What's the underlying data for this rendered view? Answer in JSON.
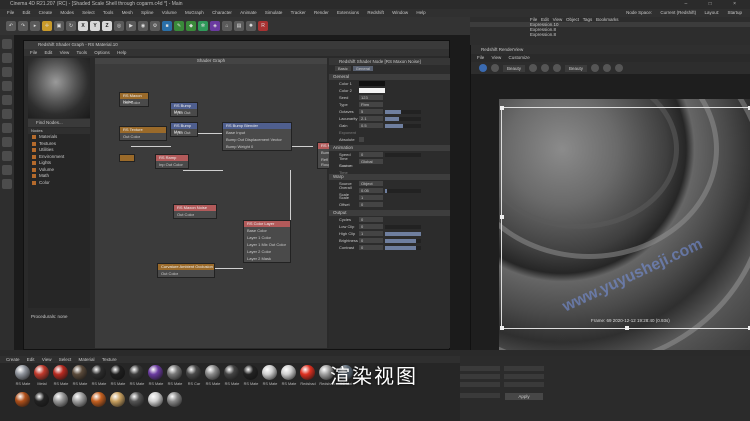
{
  "window": {
    "title": "Cinema 4D R21.207 (RC) - [Shaded Scale Shell through cogarm.c4d *] - Main",
    "controls": [
      "–",
      "□",
      "×"
    ]
  },
  "menubar": {
    "items": [
      "File",
      "Edit",
      "Create",
      "Modes",
      "Select",
      "Tools",
      "Mesh",
      "Spline",
      "Volume",
      "MoGraph",
      "Character",
      "Animate",
      "Simulate",
      "Tracker",
      "Render",
      "Extensions",
      "Redshift",
      "Window",
      "Help"
    ],
    "node_space_label": "Node Space:",
    "node_space_value": "Current (Redshift)",
    "layout_label": "Layout:",
    "layout_value": "Startup"
  },
  "toolbar": {
    "axis_buttons": [
      "X",
      "Y",
      "Z"
    ]
  },
  "object_manager": {
    "menu": [
      "File",
      "Edit",
      "View",
      "Object",
      "Tags",
      "Bookmarks"
    ],
    "rows": [
      "Expression.10",
      "Expression.8",
      "Expression.8"
    ]
  },
  "shader_graph": {
    "title": "Redshift Shader Graph - RS Material.10",
    "menu": [
      "File",
      "Edit",
      "View",
      "Tools",
      "Options",
      "Help"
    ],
    "graph_title": "Shader Graph",
    "find_nodes_placeholder": "Find Nodes...",
    "nodes_header": "Nodes",
    "categories": [
      "Materials",
      "Textures",
      "Utilities",
      "Environment",
      "Lights",
      "Volume",
      "Math",
      "Color"
    ],
    "properties_label": "Procedurals: none",
    "nodes": [
      {
        "name": "RS Maxon Noise",
        "ports": [
          "Out Color"
        ]
      },
      {
        "name": "RS Bump Map",
        "ports": [
          "Input Out"
        ]
      },
      {
        "name": "RS Bump Map",
        "ports": [
          "Input Out"
        ]
      },
      {
        "name": "RS Texture",
        "ports": [
          "Out Color"
        ]
      },
      {
        "name": "RS Bump Blender",
        "ports": [
          "Base Input",
          "Bump Out Displacement Vector",
          "Bump Weight 0"
        ]
      },
      {
        "name": "RS Ramp",
        "ports": [
          "Inp Out Color"
        ]
      },
      {
        "name": "RS Mat",
        "ports": [
          "Bump Input",
          "Refl Roughness"
        ]
      },
      {
        "name": "RS Maxon Noise",
        "ports": [
          "Out Color"
        ]
      },
      {
        "name": "RS Color Layer",
        "ports": [
          "Base Color",
          "Layer 1 Color",
          "Layer 1 Mix Out Color",
          "Layer 2 Color",
          "Layer 2 Mask"
        ]
      },
      {
        "name": "Curvature Ambient Occlusion",
        "ports": [
          "Out Color"
        ]
      }
    ]
  },
  "attributes": {
    "header": "Redshift Shader Node [RS Maxon Noise]",
    "tabs": [
      "Basic",
      "General"
    ],
    "active_tab": "General",
    "sections": {
      "general": "General",
      "animation": "Animation",
      "warp": "Warp",
      "output": "Output"
    },
    "general_props": [
      {
        "label": "Color 1",
        "value": "",
        "fill": 0
      },
      {
        "label": "Color 2",
        "value": "",
        "fill": 0
      },
      {
        "label": "Seed",
        "value": "123",
        "fill": 0
      },
      {
        "label": "Type",
        "value": "Fbm",
        "fill": 0
      },
      {
        "label": "Octaves",
        "value": "5",
        "fill": 0.45
      },
      {
        "label": "Lacunarity",
        "value": "2.1",
        "fill": 0.4
      },
      {
        "label": "Gain",
        "value": "0.5",
        "fill": 0.5
      },
      {
        "label": "Exponent",
        "value": "",
        "fill": 0
      },
      {
        "label": "Absolute",
        "value": "",
        "fill": 0
      }
    ],
    "animation_props": [
      {
        "label": "Speed",
        "value": "0",
        "fill": 0
      },
      {
        "label": "Time Source",
        "value": "Global",
        "fill": 0
      },
      {
        "label": "Custom Time",
        "value": "",
        "fill": 0
      }
    ],
    "warp_props": [
      {
        "label": "Source",
        "value": "Object",
        "fill": 0
      },
      {
        "label": "Overall Scale",
        "value": "0.05",
        "fill": 0.05
      },
      {
        "label": "Scale",
        "value": "1",
        "fill": 0
      },
      {
        "label": "Offset",
        "value": "0",
        "fill": 0
      }
    ],
    "output_props": [
      {
        "label": "Cycles",
        "value": "0",
        "fill": 0
      },
      {
        "label": "Low Clip",
        "value": "0",
        "fill": 0
      },
      {
        "label": "High Clip",
        "value": "1",
        "fill": 1
      },
      {
        "label": "Brightness",
        "value": "0",
        "fill": 0.85
      },
      {
        "label": "Contrast",
        "value": "0",
        "fill": 0.85
      }
    ]
  },
  "render_view": {
    "title": "Redshift RenderView",
    "menu": [
      "File",
      "View",
      "Customize"
    ],
    "beauty_label": "Beauty",
    "aov_label": "Beauty",
    "frame_info": "Frame: 69  2020-12-12  19:28:40  (0.93s)"
  },
  "materials": {
    "menu": [
      "Create",
      "Edit",
      "View",
      "Select",
      "Material",
      "Texture"
    ],
    "row1": [
      "RS Mate",
      "Metal",
      "RS Mate",
      "RS Mate",
      "RS Mate",
      "RS Mate",
      "RS Mate",
      "RS Mate",
      "RS Mate",
      "RS Car",
      "RS Mate",
      "RS Mate",
      "RS Mate",
      "RS Mate",
      "RS Mate",
      "Redshad",
      "Redshad",
      "RS Mat"
    ],
    "row2": [
      "",
      "",
      "",
      "",
      "",
      "",
      "",
      "",
      ""
    ],
    "colors_row1": [
      "#8f949c",
      "#c13a2c",
      "#b82a20",
      "#5a4a3a",
      "#2d2d2d",
      "#1e1e1e",
      "#3a3a3a",
      "#6a3aa0",
      "#777",
      "#4a4a4a",
      "#8a8a8a",
      "#444",
      "#222",
      "#cfcfcf",
      "#d0d0d0",
      "#e03020",
      "#a0a0a0",
      "#6a7a8a"
    ],
    "colors_row2": [
      "#b0501a",
      "#222",
      "#999",
      "#a0a0a0",
      "#c56020",
      "#c8a060",
      "#555",
      "#d0d0d0",
      "#888"
    ]
  },
  "attr_panel": {
    "apply_label": "Apply"
  },
  "subtitle": "渲染视图",
  "watermark": "www.yuyusheji.com"
}
